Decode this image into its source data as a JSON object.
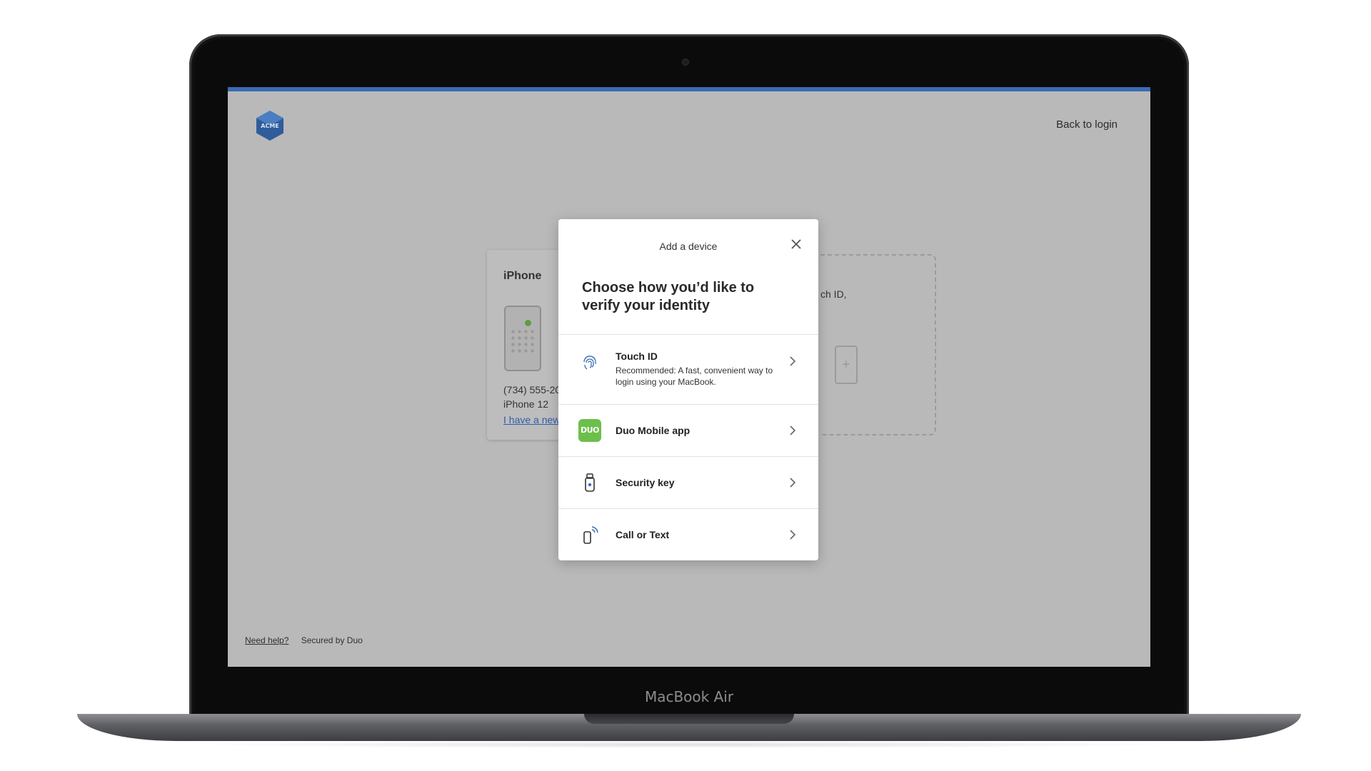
{
  "device_label": "MacBook Air",
  "header": {
    "logo_text": "ACME",
    "back_link": "Back to login"
  },
  "background": {
    "device_card": {
      "title": "iPhone",
      "phone_number": "(734) 555-20",
      "model": "iPhone 12",
      "link": "I have a new"
    },
    "dashed_card": {
      "text": "ch ID,"
    }
  },
  "modal": {
    "title": "Add a device",
    "heading": "Choose how you’d like to verify your identity",
    "options": [
      {
        "title": "Touch ID",
        "description": "Recommended: A fast, convenient way to login using your MacBook.",
        "icon": "fingerprint-icon"
      },
      {
        "title": "Duo Mobile app",
        "icon": "duo-icon",
        "badge": "DUO"
      },
      {
        "title": "Security key",
        "icon": "security-key-icon"
      },
      {
        "title": "Call or Text",
        "icon": "phone-signal-icon"
      }
    ]
  },
  "footer": {
    "help": "Need help?",
    "secured": "Secured by Duo"
  },
  "colors": {
    "accent": "#3a6ab3",
    "duo_green": "#6dbf4b",
    "screen_overlay": "#b9b9b9"
  }
}
